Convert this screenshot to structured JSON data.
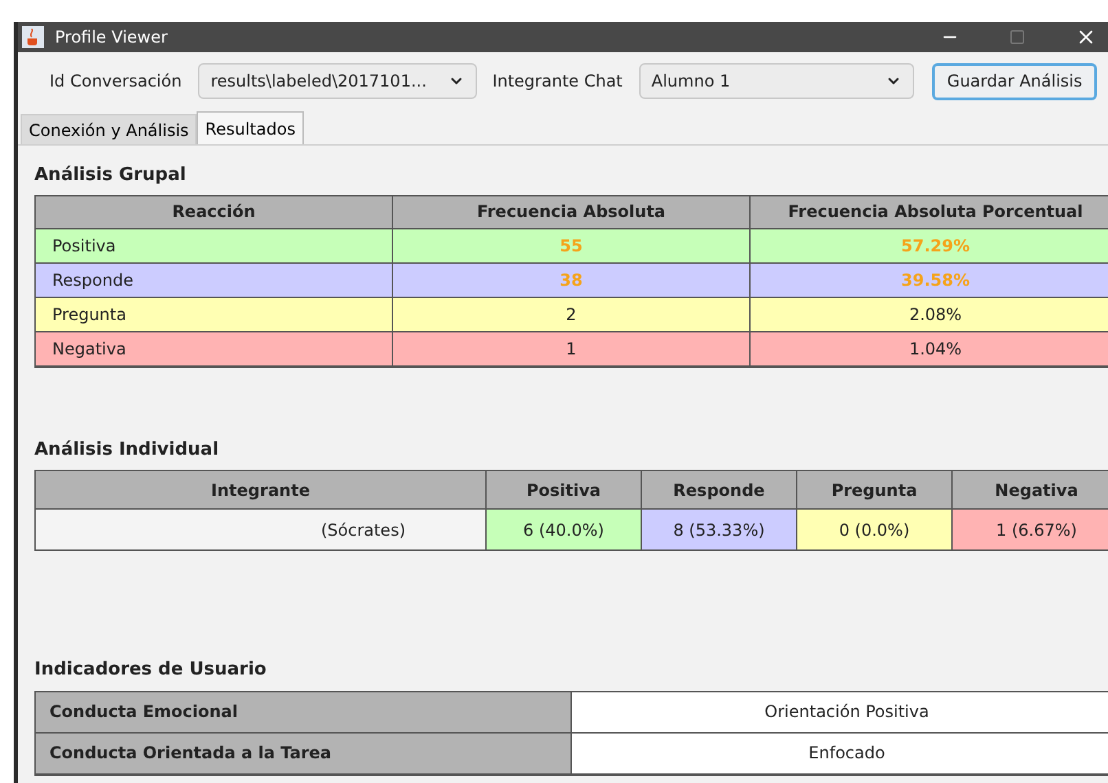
{
  "window": {
    "title": "Profile Viewer"
  },
  "toolbar": {
    "conversation_label": "Id Conversación",
    "conversation_value": "results\\labeled\\2017101...",
    "member_label": "Integrante Chat",
    "member_value": "Alumno 1",
    "save_button": "Guardar Análisis"
  },
  "tabs": [
    {
      "label": "Conexión y Análisis",
      "selected": false
    },
    {
      "label": "Resultados",
      "selected": true
    }
  ],
  "group_analysis": {
    "title": "Análisis Grupal",
    "columns": [
      "Reacción",
      "Frecuencia Absoluta",
      "Frecuencia Absoluta Porcentual"
    ],
    "rows": [
      {
        "cells": [
          "Positiva",
          "55",
          "57.29%"
        ],
        "color": "#c6ffb8",
        "emphasized": true
      },
      {
        "cells": [
          "Responde",
          "38",
          "39.58%"
        ],
        "color": "#ccccff",
        "emphasized": true
      },
      {
        "cells": [
          "Pregunta",
          "2",
          "2.08%"
        ],
        "color": "#ffffb3",
        "emphasized": false
      },
      {
        "cells": [
          "Negativa",
          "1",
          "1.04%"
        ],
        "color": "#ffb3b3",
        "emphasized": false
      }
    ]
  },
  "individual_analysis": {
    "title": "Análisis Individual",
    "columns": [
      "Integrante",
      "Positiva",
      "Responde",
      "Pregunta",
      "Negativa"
    ],
    "rows": [
      {
        "cells": [
          {
            "text": "(Sócrates)",
            "color": "#f4f4f4"
          },
          {
            "text": "6 (40.0%)",
            "color": "#c6ffb8"
          },
          {
            "text": "8 (53.33%)",
            "color": "#ccccff"
          },
          {
            "text": "0 (0.0%)",
            "color": "#ffffb3"
          },
          {
            "text": "1 (6.67%)",
            "color": "#ffb3b3"
          }
        ]
      }
    ]
  },
  "user_indicators": {
    "title": "Indicadores de Usuario",
    "rows": [
      {
        "label": "Conducta Emocional",
        "value": "Orientación Positiva"
      },
      {
        "label": "Conducta Orientada a la Tarea",
        "value": "Enfocado"
      }
    ]
  }
}
